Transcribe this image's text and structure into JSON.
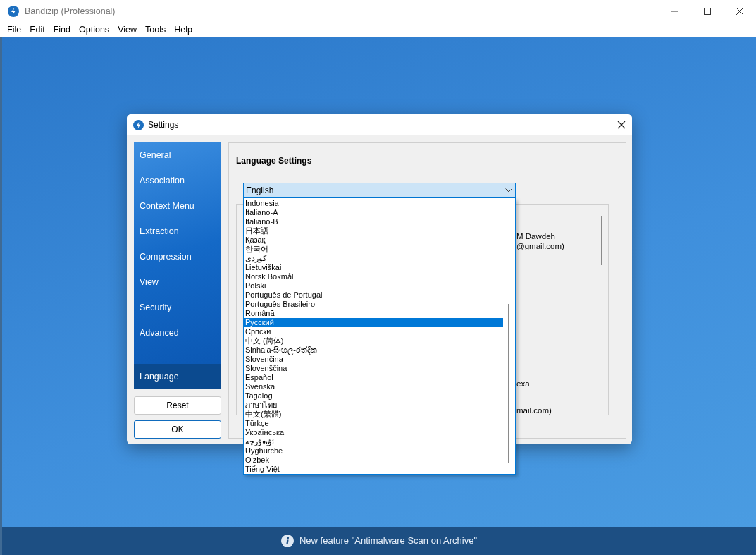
{
  "window": {
    "title": "Bandizip (Professional)"
  },
  "menu": [
    "File",
    "Edit",
    "Find",
    "Options",
    "View",
    "Tools",
    "Help"
  ],
  "dialog": {
    "title": "Settings",
    "nav": [
      {
        "label": "General",
        "selected": false
      },
      {
        "label": "Association",
        "selected": false
      },
      {
        "label": "Context Menu",
        "selected": false
      },
      {
        "label": "Extraction",
        "selected": false
      },
      {
        "label": "Compression",
        "selected": false
      },
      {
        "label": "View",
        "selected": false
      },
      {
        "label": "Security",
        "selected": false
      },
      {
        "label": "Advanced",
        "selected": false
      },
      {
        "label": "Language",
        "selected": true
      }
    ],
    "buttons": [
      "Reset",
      "OK"
    ],
    "section_title": "Language Settings",
    "language_select": {
      "value": "English",
      "options": [
        {
          "label": "Indonesia",
          "selected": false
        },
        {
          "label": "Italiano-A",
          "selected": false
        },
        {
          "label": "Italiano-B",
          "selected": false
        },
        {
          "label": "日本語",
          "selected": false
        },
        {
          "label": "Қазақ",
          "selected": false
        },
        {
          "label": "한국어",
          "selected": false
        },
        {
          "label": "کوردی",
          "selected": false
        },
        {
          "label": "Lietuviškai",
          "selected": false
        },
        {
          "label": "Norsk Bokmål",
          "selected": false
        },
        {
          "label": "Polski",
          "selected": false
        },
        {
          "label": "Português de Portugal",
          "selected": false
        },
        {
          "label": "Português Brasileiro",
          "selected": false
        },
        {
          "label": "Română",
          "selected": false
        },
        {
          "label": "Русский",
          "selected": true
        },
        {
          "label": "Српски",
          "selected": false
        },
        {
          "label": "中文 (简体)",
          "selected": false
        },
        {
          "label": "Sinhala-සිංහල-රත්දික",
          "selected": false
        },
        {
          "label": "Slovenčina",
          "selected": false
        },
        {
          "label": "Slovenščina",
          "selected": false
        },
        {
          "label": "Español",
          "selected": false
        },
        {
          "label": "Svenska",
          "selected": false
        },
        {
          "label": "Tagalog",
          "selected": false
        },
        {
          "label": "ภาษาไทย",
          "selected": false
        },
        {
          "label": "中文(繁體)",
          "selected": false
        },
        {
          "label": "Türkçe",
          "selected": false
        },
        {
          "label": "Українська",
          "selected": false
        },
        {
          "label": "ئۇيغۇرچە",
          "selected": false
        },
        {
          "label": "Uyghurche",
          "selected": false
        },
        {
          "label": "O'zbek",
          "selected": false
        },
        {
          "label": "Tiếng Việt",
          "selected": false
        }
      ]
    },
    "credits_panel": {
      "lines": [
        "M Dawdeh",
        "@gmail.com)",
        "exa",
        "mail.com)"
      ]
    }
  },
  "notification": {
    "text": "New feature \"Antimalware Scan on Archive\""
  }
}
